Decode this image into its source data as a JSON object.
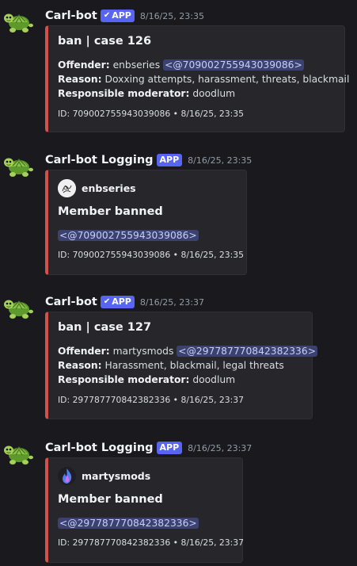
{
  "messages": [
    {
      "author": "Carl-bot",
      "badge": "APP",
      "badge_check": true,
      "timestamp": "8/16/25, 23:35",
      "embed": {
        "title": "ban | case 126",
        "offender_label": "Offender:",
        "offender_name": "enbseries",
        "offender_mention": "<@709002755943039086>",
        "reason_label": "Reason:",
        "reason": "Doxxing attempts, harassment, threats, blackmail",
        "moderator_label": "Responsible moderator:",
        "moderator": "doodlum",
        "footer": "ID: 709002755943039086 • 8/16/25, 23:35"
      }
    },
    {
      "author": "Carl-bot Logging",
      "badge": "APP",
      "badge_check": false,
      "timestamp": "8/16/25, 23:35",
      "embed": {
        "author_name": "enbseries",
        "title": "Member banned",
        "mention": "<@709002755943039086>",
        "footer": "ID: 709002755943039086 • 8/16/25, 23:35"
      }
    },
    {
      "author": "Carl-bot",
      "badge": "APP",
      "badge_check": true,
      "timestamp": "8/16/25, 23:37",
      "embed": {
        "title": "ban | case 127",
        "offender_label": "Offender:",
        "offender_name": "martysmods",
        "offender_mention": "<@297787770842382336>",
        "reason_label": "Reason:",
        "reason": "Harassment, blackmail, legal threats",
        "moderator_label": "Responsible moderator:",
        "moderator": "doodlum",
        "footer": "ID: 297787770842382336 • 8/16/25, 23:37"
      }
    },
    {
      "author": "Carl-bot Logging",
      "badge": "APP",
      "badge_check": false,
      "timestamp": "8/16/25, 23:37",
      "embed": {
        "author_name": "martysmods",
        "title": "Member banned",
        "mention": "<@297787770842382336>",
        "footer": "ID: 297787770842382336 • 8/16/25, 23:37"
      }
    }
  ],
  "colors": {
    "background": "#1a1a1e",
    "embed_background": "#26262b",
    "embed_accent": "#d0524a",
    "badge": "#5865f2",
    "mention_bg": "#3c4270",
    "mention_text": "#c9cdfb"
  },
  "icons": {
    "avatar": "turtle-avatar-icon",
    "check": "check-icon",
    "enbseries_avatar": "sketch-avatar-icon",
    "martysmods_avatar": "flame-avatar-icon"
  }
}
